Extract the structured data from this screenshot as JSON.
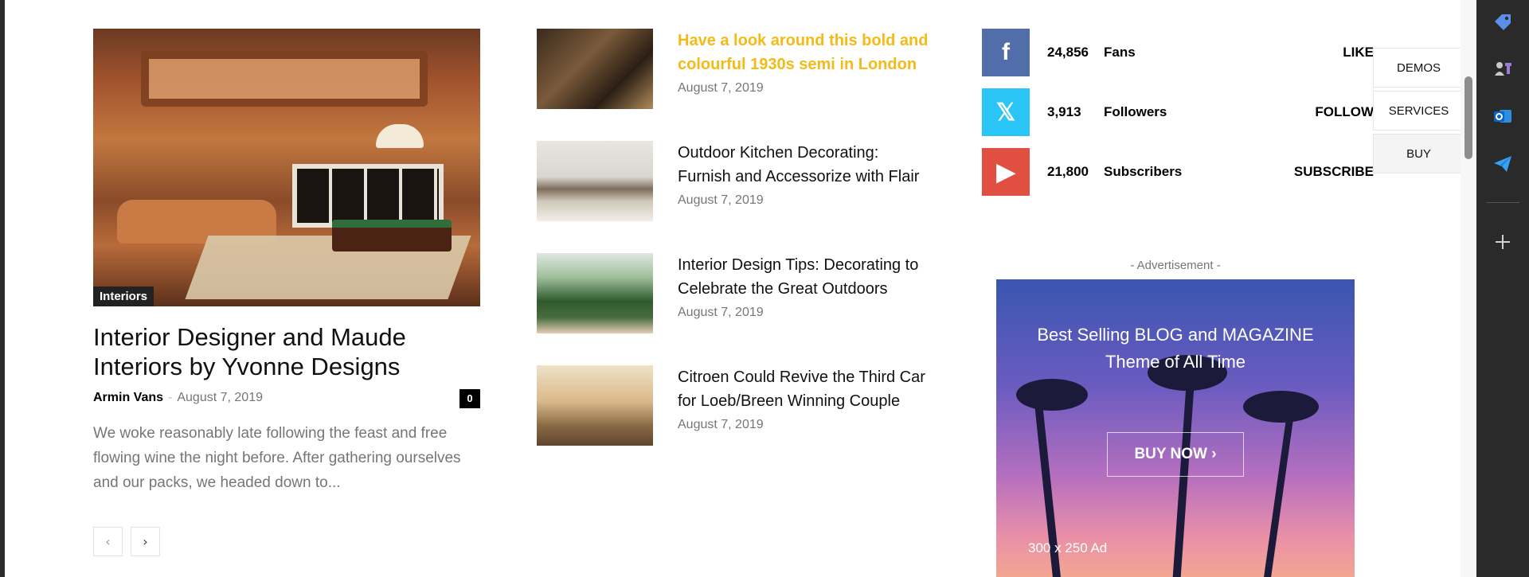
{
  "featured": {
    "category": "Interiors",
    "title": "Interior Designer and Maude Interiors by Yvonne Designs",
    "author": "Armin Vans",
    "separator": "-",
    "date": "August 7, 2019",
    "comments": "0",
    "excerpt": "We woke reasonably late following the feast and free flowing wine the night before. After gathering ourselves and our packs, we headed down to...",
    "pager_prev": "‹",
    "pager_next": "›"
  },
  "list": [
    {
      "title": "Have a look around this bold and colourful 1930s semi in London",
      "date": "August 7, 2019"
    },
    {
      "title": "Outdoor Kitchen Decorating: Furnish and Accessorize with Flair",
      "date": "August 7, 2019"
    },
    {
      "title": "Interior Design Tips: Decorating to Celebrate the Great Outdoors",
      "date": "August 7, 2019"
    },
    {
      "title": "Citroen Could Revive the Third Car for Loeb/Breen Winning Couple",
      "date": "August 7, 2019"
    }
  ],
  "social": [
    {
      "icon": "facebook-icon",
      "glyph": "f",
      "count": "24,856",
      "label": "Fans",
      "action": "LIKE",
      "color": "#516eab"
    },
    {
      "icon": "x-icon",
      "glyph": "𝕏",
      "count": "3,913",
      "label": "Followers",
      "action": "FOLLOW",
      "color": "#29c5f6"
    },
    {
      "icon": "youtube-icon",
      "glyph": "▶",
      "count": "21,800",
      "label": "Subscribers",
      "action": "SUBSCRIBE",
      "color": "#e14e42"
    }
  ],
  "ad": {
    "label": "- Advertisement -",
    "headline_line1": "Best Selling BLOG and MAGAZINE",
    "headline_line2": "Theme of All Time",
    "button": "BUY NOW ›",
    "size": "300 x 250 Ad"
  },
  "float_menu": {
    "demos": "DEMOS",
    "services": "SERVICES",
    "buy": "BUY"
  },
  "colors": {
    "highlight": "#f3bb17",
    "meta": "#767676"
  }
}
